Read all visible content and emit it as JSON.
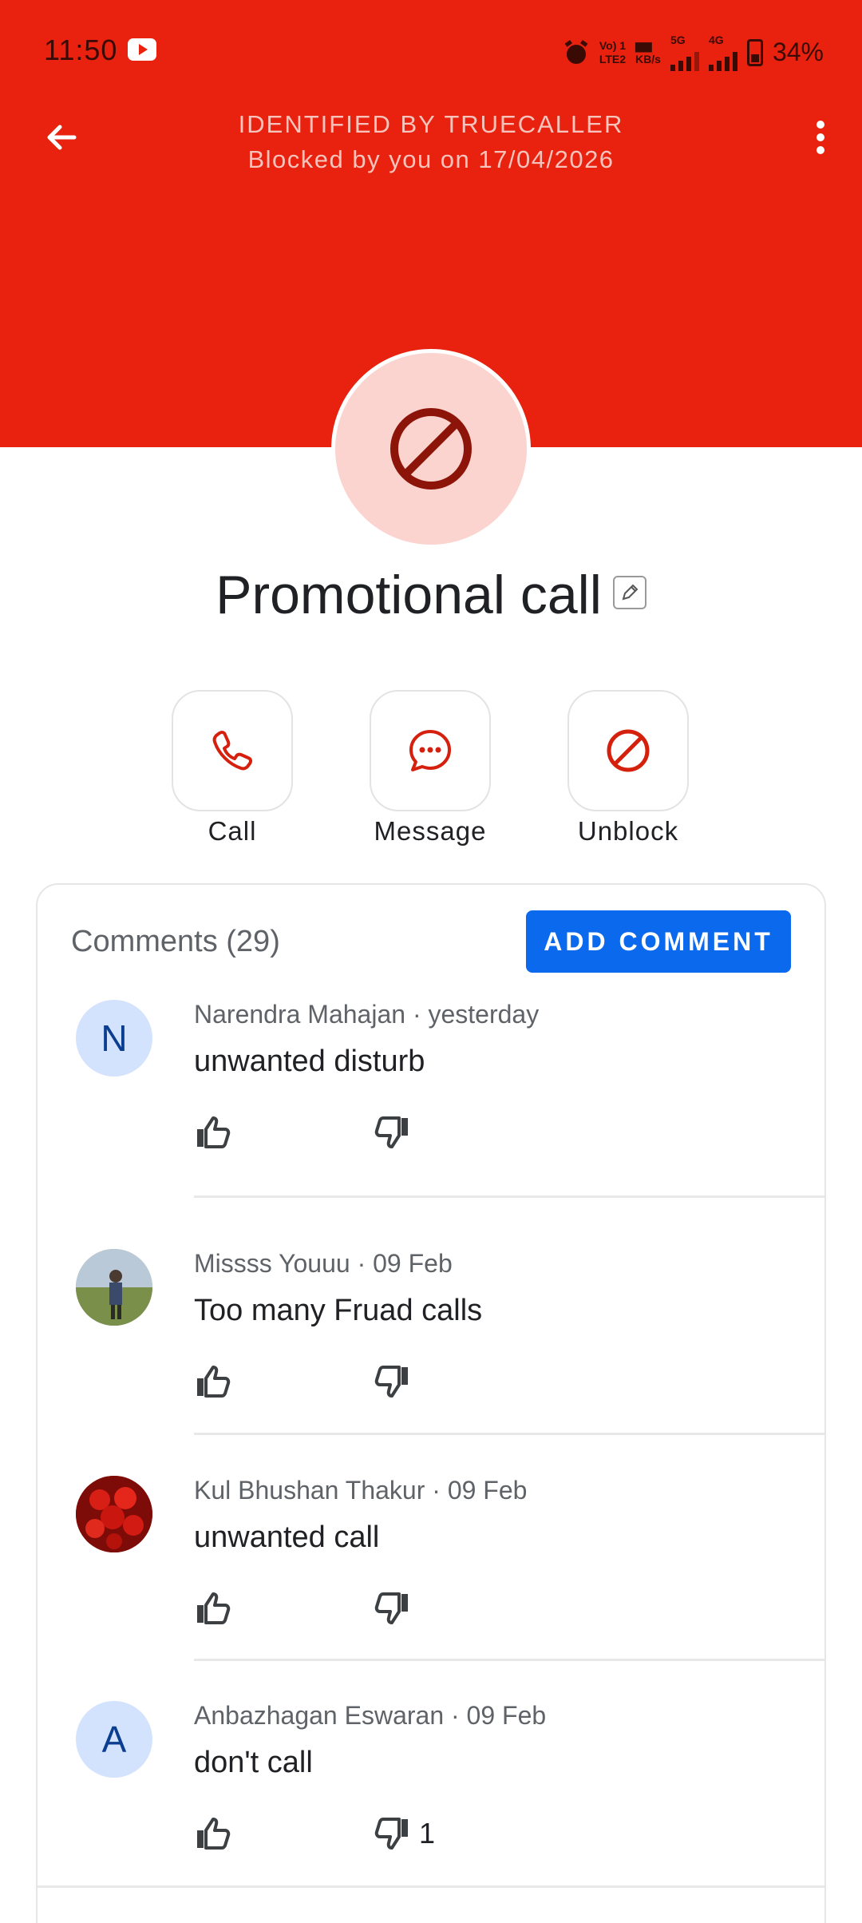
{
  "status_bar": {
    "time": "11:50",
    "net_label_top": "Vo) 1",
    "net_label_bottom": "LTE2",
    "speed_label_bottom": "KB/s",
    "net_5g": "5G",
    "net_4g": "4G",
    "battery": "34%"
  },
  "header": {
    "identified_by": "IDENTIFIED BY TRUECALLER",
    "blocked_on": "Blocked by you on 17/04/2026",
    "background_color": "#e8220f"
  },
  "contact": {
    "name": "Promotional call"
  },
  "actions": [
    {
      "label": "Call",
      "icon": "phone-icon"
    },
    {
      "label": "Message",
      "icon": "chat-bubble-icon"
    },
    {
      "label": "Unblock",
      "icon": "block-icon"
    }
  ],
  "comments": {
    "title": "Comments (29)",
    "add_button": "ADD COMMENT",
    "items": [
      {
        "avatar_letter": "N",
        "meta": "Narendra Mahajan · yesterday",
        "text": "unwanted disturb",
        "dislikes": ""
      },
      {
        "avatar_letter": "",
        "meta": "Missss Youuu · 09 Feb",
        "text": "Too many Fruad calls",
        "dislikes": ""
      },
      {
        "avatar_letter": "",
        "meta": "Kul Bhushan Thakur · 09 Feb",
        "text": "unwanted call",
        "dislikes": ""
      },
      {
        "avatar_letter": "A",
        "meta": "Anbazhagan Eswaran · 09 Feb",
        "text": "don't call",
        "dislikes": "1"
      }
    ]
  }
}
